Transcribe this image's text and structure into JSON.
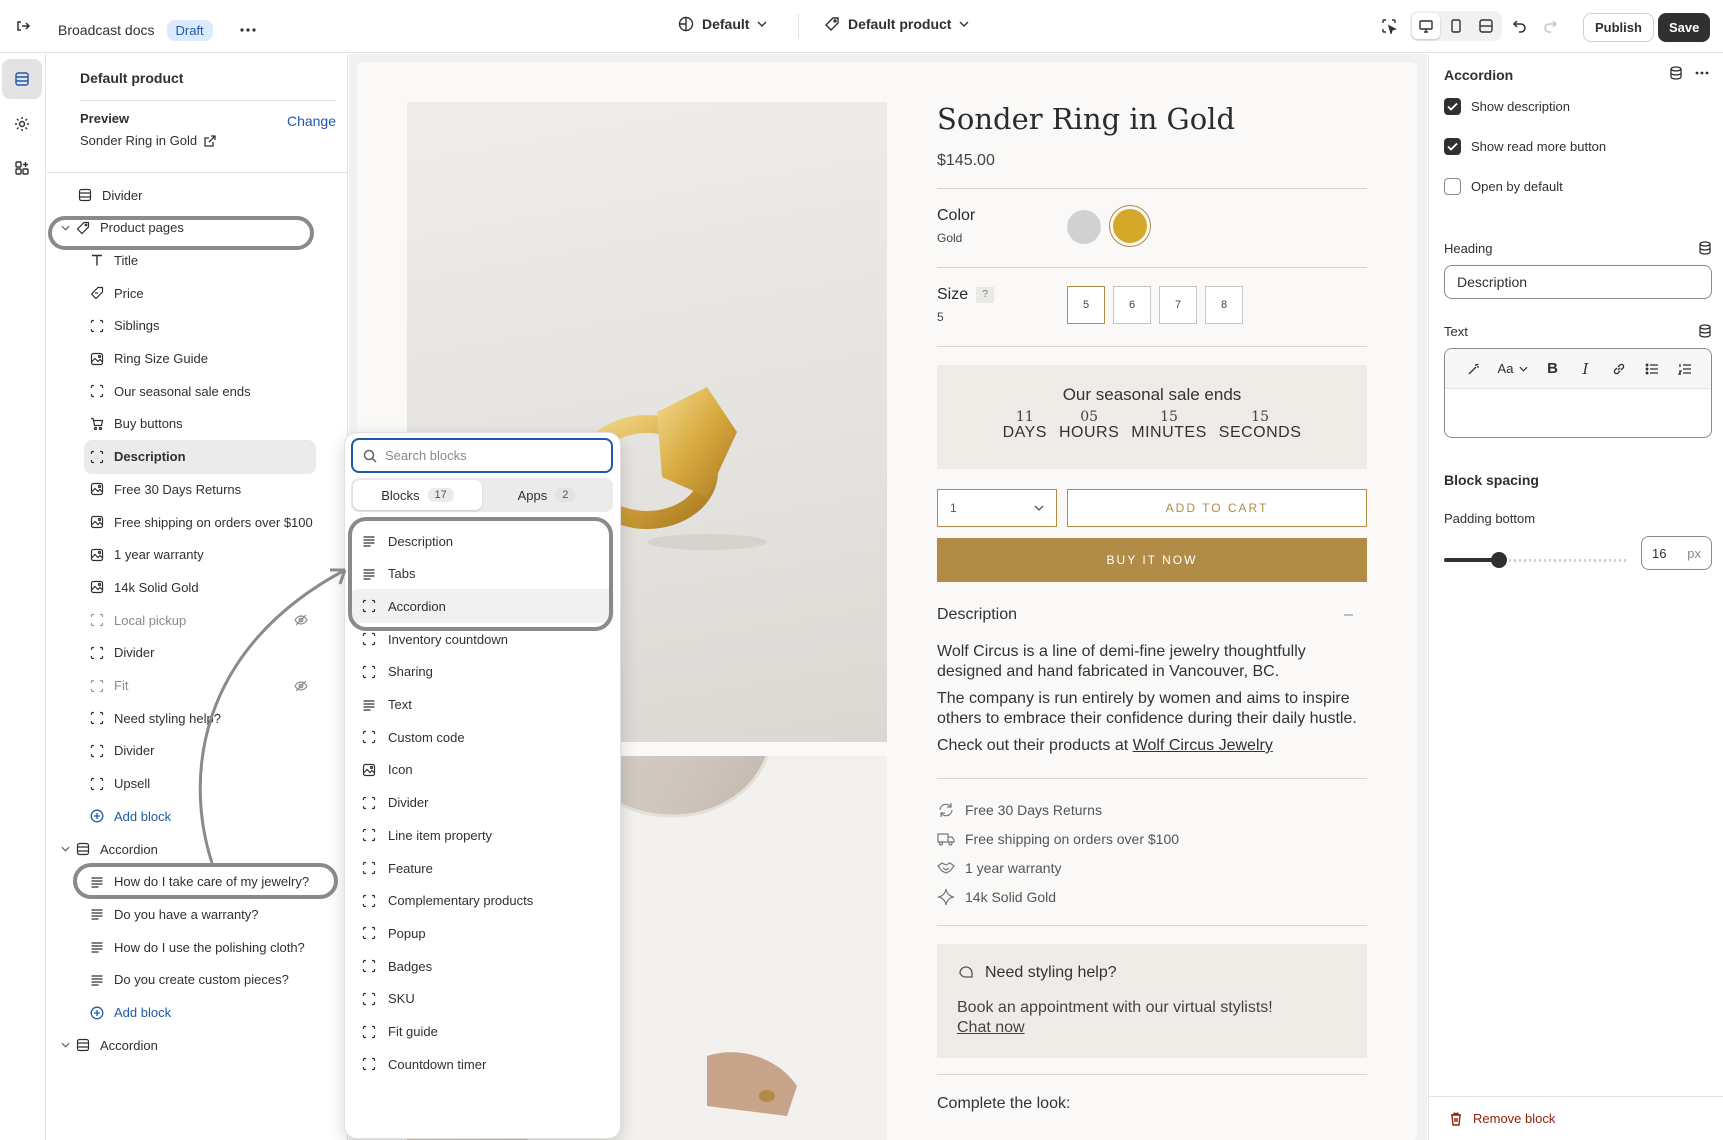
{
  "topbar": {
    "doc_title": "Broadcast docs",
    "status_badge": "Draft",
    "theme_dropdown": "Default",
    "template_dropdown": "Default product",
    "publish_label": "Publish",
    "save_label": "Save"
  },
  "left_panel": {
    "title": "Default product",
    "preview_label": "Preview",
    "preview_change": "Change",
    "preview_value": "Sonder Ring in Gold",
    "tree": [
      {
        "label": "Divider",
        "icon": "section-icon",
        "level": 0
      },
      {
        "label": "Product pages",
        "icon": "tag-icon",
        "level": 0,
        "expanded": true
      },
      {
        "label": "Title",
        "icon": "text-title-icon",
        "level": 1
      },
      {
        "label": "Price",
        "icon": "price-tag-icon",
        "level": 1
      },
      {
        "label": "Siblings",
        "icon": "block-icon",
        "level": 1
      },
      {
        "label": "Ring Size Guide",
        "icon": "image-block-icon",
        "level": 1
      },
      {
        "label": "Our seasonal sale ends",
        "icon": "block-icon",
        "level": 1
      },
      {
        "label": "Buy buttons",
        "icon": "cart-icon",
        "level": 1
      },
      {
        "label": "Description",
        "icon": "block-icon",
        "level": 1,
        "selected": true
      },
      {
        "label": "Free 30 Days Returns",
        "icon": "image-block-icon",
        "level": 1
      },
      {
        "label": "Free shipping on orders over $100",
        "icon": "image-block-icon",
        "level": 1
      },
      {
        "label": "1 year warranty",
        "icon": "image-block-icon",
        "level": 1
      },
      {
        "label": "14k Solid Gold",
        "icon": "image-block-icon",
        "level": 1
      },
      {
        "label": "Local pickup",
        "icon": "block-icon",
        "level": 1,
        "hidden": true
      },
      {
        "label": "Divider",
        "icon": "block-icon",
        "level": 1
      },
      {
        "label": "Fit",
        "icon": "block-icon",
        "level": 1,
        "hidden": true
      },
      {
        "label": "Need styling help?",
        "icon": "block-icon",
        "level": 1
      },
      {
        "label": "Divider",
        "icon": "block-icon",
        "level": 1
      },
      {
        "label": "Upsell",
        "icon": "block-icon",
        "level": 1
      },
      {
        "label": "Add block",
        "icon": "plus-circle-icon",
        "level": 1,
        "action": true
      },
      {
        "label": "Accordion",
        "icon": "section-icon",
        "level": 0,
        "expanded": true
      },
      {
        "label": "How do I take care of my jewelry?",
        "icon": "lines-icon",
        "level": 1
      },
      {
        "label": "Do you have a warranty?",
        "icon": "lines-icon",
        "level": 1
      },
      {
        "label": "How do I use the polishing cloth?",
        "icon": "lines-icon",
        "level": 1
      },
      {
        "label": "Do you create custom pieces?",
        "icon": "lines-icon",
        "level": 1
      },
      {
        "label": "Add block",
        "icon": "plus-circle-icon",
        "level": 1,
        "action": true
      },
      {
        "label": "Accordion",
        "icon": "section-icon",
        "level": 0,
        "expanded": true
      }
    ]
  },
  "block_picker": {
    "search_placeholder": "Search blocks",
    "tabs": [
      {
        "label": "Blocks",
        "count": "17",
        "active": true
      },
      {
        "label": "Apps",
        "count": "2",
        "active": false
      }
    ],
    "items": [
      {
        "label": "Description",
        "icon": "lines-icon"
      },
      {
        "label": "Tabs",
        "icon": "lines-icon"
      },
      {
        "label": "Accordion",
        "icon": "block-icon",
        "selected": true
      },
      {
        "label": "Inventory countdown",
        "icon": "block-icon"
      },
      {
        "label": "Sharing",
        "icon": "block-icon"
      },
      {
        "label": "Text",
        "icon": "lines-icon"
      },
      {
        "label": "Custom code",
        "icon": "block-icon"
      },
      {
        "label": "Icon",
        "icon": "image-block-icon"
      },
      {
        "label": "Divider",
        "icon": "block-icon"
      },
      {
        "label": "Line item property",
        "icon": "block-icon"
      },
      {
        "label": "Feature",
        "icon": "block-icon"
      },
      {
        "label": "Complementary products",
        "icon": "block-icon"
      },
      {
        "label": "Popup",
        "icon": "block-icon"
      },
      {
        "label": "Badges",
        "icon": "block-icon"
      },
      {
        "label": "SKU",
        "icon": "block-icon"
      },
      {
        "label": "Fit guide",
        "icon": "block-icon"
      },
      {
        "label": "Countdown timer",
        "icon": "block-icon"
      }
    ]
  },
  "product": {
    "title": "Sonder Ring in Gold",
    "price": "$145.00",
    "color_label": "Color",
    "color_value": "Gold",
    "swatches": [
      "#d1d1d1",
      "#d4a92a"
    ],
    "size_label": "Size",
    "size_help": "?",
    "size_value": "5",
    "sizes": [
      "5",
      "6",
      "7",
      "8"
    ],
    "sale_heading": "Our seasonal sale ends",
    "countdown": [
      {
        "num": "11",
        "unit": "DAYS"
      },
      {
        "num": "05",
        "unit": "HOURS"
      },
      {
        "num": "15",
        "unit": "MINUTES"
      },
      {
        "num": "15",
        "unit": "SECONDS"
      }
    ],
    "qty": "1",
    "add_to_cart": "ADD TO CART",
    "buy_now": "BUY IT NOW",
    "description_heading": "Description",
    "description_toggle": "–",
    "description_p1": "Wolf Circus is a line of demi-fine jewelry thoughtfully designed and hand fabricated in Vancouver, BC.",
    "description_p2": "The company is run entirely by women and aims to inspire others to embrace their confidence during their daily hustle.",
    "description_p3_prefix": "Check out their products at ",
    "description_p3_link": "Wolf Circus Jewelry",
    "features": [
      {
        "label": "Free 30 Days Returns",
        "icon": "refresh-icon"
      },
      {
        "label": "Free shipping on orders over $100",
        "icon": "truck-icon"
      },
      {
        "label": "1 year warranty",
        "icon": "handshake-icon"
      },
      {
        "label": "14k Solid Gold",
        "icon": "sparkle-icon"
      }
    ],
    "styling_heading": "Need styling help?",
    "styling_text": "Book an appointment with our virtual stylists!",
    "styling_link": "Chat now",
    "complete_look": "Complete the look:"
  },
  "right_panel": {
    "title": "Accordion",
    "checkboxes": [
      {
        "label": "Show description",
        "checked": true
      },
      {
        "label": "Show read more button",
        "checked": true
      },
      {
        "label": "Open by default",
        "checked": false
      }
    ],
    "heading_label": "Heading",
    "heading_value": "Description",
    "text_label": "Text",
    "font_size_label": "Aa",
    "bold_label": "B",
    "italic_label": "I",
    "spacing_heading": "Block spacing",
    "padding_label": "Padding bottom",
    "padding_value": "16",
    "padding_unit": "px",
    "padding_fraction": 0.3,
    "remove_label": "Remove block"
  },
  "colors": {
    "accent_gold": "#b08c46",
    "primary_dark": "#303030",
    "link_blue": "#1e5aa8",
    "danger": "#8e1f0b"
  }
}
